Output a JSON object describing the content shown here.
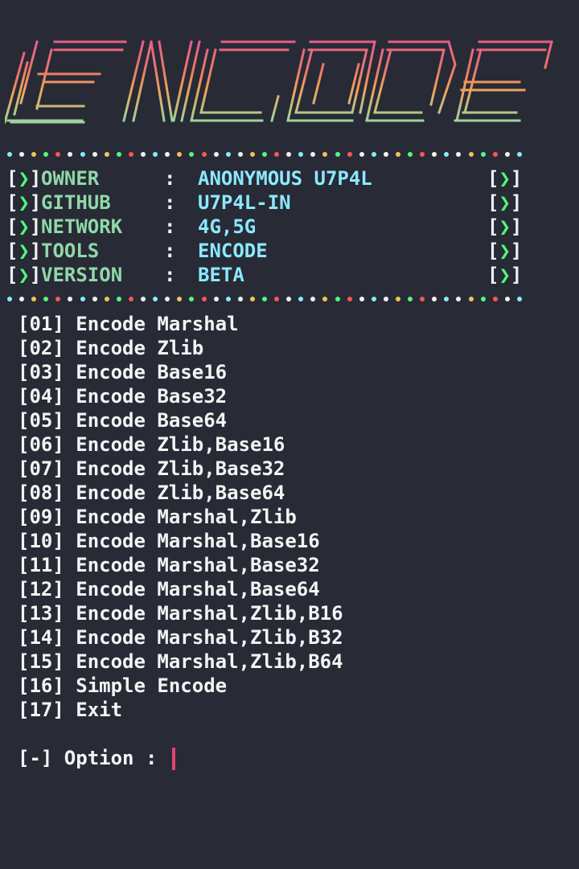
{
  "banner": {
    "text": "ENCODE",
    "colors": [
      "#e65f85",
      "#e9786a",
      "#f0a25a",
      "#f1c454",
      "#9fd39a"
    ]
  },
  "dot_colors": [
    "#8be9fd",
    "#f1f1f1",
    "#f1c454",
    "#50fa7b",
    "#ff5555",
    "#f1f1f1"
  ],
  "info": [
    {
      "key": "OWNER",
      "value": "ANONYMOUS U7P4L"
    },
    {
      "key": "GITHUB",
      "value": "U7P4L-IN"
    },
    {
      "key": "NETWORK",
      "value": "4G,5G"
    },
    {
      "key": "TOOLS",
      "value": "ENCODE"
    },
    {
      "key": "VERSION",
      "value": "BETA"
    }
  ],
  "info_bracket_open": "[",
  "info_arrow": "❯",
  "info_bracket_close": "]",
  "info_colon": ":",
  "menu": [
    {
      "num": "[01]",
      "label": "Encode Marshal"
    },
    {
      "num": "[02]",
      "label": "Encode Zlib"
    },
    {
      "num": "[03]",
      "label": "Encode Base16"
    },
    {
      "num": "[04]",
      "label": "Encode Base32"
    },
    {
      "num": "[05]",
      "label": "Encode Base64"
    },
    {
      "num": "[06]",
      "label": "Encode Zlib,Base16"
    },
    {
      "num": "[07]",
      "label": "Encode Zlib,Base32"
    },
    {
      "num": "[08]",
      "label": "Encode Zlib,Base64"
    },
    {
      "num": "[09]",
      "label": "Encode Marshal,Zlib"
    },
    {
      "num": "[10]",
      "label": "Encode Marshal,Base16"
    },
    {
      "num": "[11]",
      "label": "Encode Marshal,Base32"
    },
    {
      "num": "[12]",
      "label": "Encode Marshal,Base64"
    },
    {
      "num": "[13]",
      "label": "Encode Marshal,Zlib,B16"
    },
    {
      "num": "[14]",
      "label": "Encode Marshal,Zlib,B32"
    },
    {
      "num": "[15]",
      "label": "Encode Marshal,Zlib,B64"
    },
    {
      "num": "[16]",
      "label": "Simple Encode"
    },
    {
      "num": "[17]",
      "label": "Exit"
    }
  ],
  "prompt": {
    "text": "[-] Option : ",
    "cursor_color": "#e0456c"
  }
}
